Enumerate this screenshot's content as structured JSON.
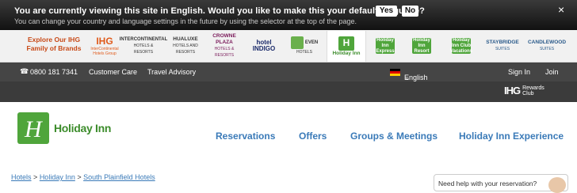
{
  "language_banner": {
    "question": "You are currently viewing this site in English. Would you like to make this your default language?",
    "subtext": "You can change your country and language settings in the future by using the selector at the top of the page.",
    "yes_label": "Yes",
    "no_label": "No",
    "close": "×"
  },
  "brands": {
    "intro": "Explore Our IHG Family of Brands",
    "items": [
      {
        "name": "IHG",
        "sub": "InterContinental Hotels Group"
      },
      {
        "name": "INTERCONTINENTAL",
        "sub": "HOTELS & RESORTS"
      },
      {
        "name": "HUALUXE",
        "sub": "HOTELS AND RESORTS"
      },
      {
        "name": "CROWNE PLAZA",
        "sub": "HOTELS & RESORTS"
      },
      {
        "name": "hotel INDIGO",
        "sub": ""
      },
      {
        "name": "EVEN",
        "sub": "HOTELS"
      },
      {
        "name": "Holiday Inn",
        "sub": ""
      },
      {
        "name": "Holiday Inn Express",
        "sub": ""
      },
      {
        "name": "Holiday Inn Resort",
        "sub": ""
      },
      {
        "name": "Holiday Inn Club Vacations",
        "sub": ""
      },
      {
        "name": "STAYBRIDGE",
        "sub": "SUITES"
      },
      {
        "name": "CANDLEWOOD",
        "sub": "SUITES"
      }
    ]
  },
  "utility": {
    "phone": "0800 181 7341",
    "customer_care": "Customer Care",
    "travel_advisory": "Travel Advisory",
    "language": "English",
    "sign_in": "Sign In",
    "join": "Join"
  },
  "rewards": {
    "brand": "IHG",
    "label_1": "Rewards",
    "label_2": "Club"
  },
  "header": {
    "logo_text": "Holiday Inn"
  },
  "nav": {
    "reservations": "Reservations",
    "offers": "Offers",
    "groups": "Groups & Meetings",
    "experience": "Holiday Inn Experience"
  },
  "breadcrumb": {
    "c1": "Hotels",
    "sep": ">",
    "c2": "Holiday Inn",
    "c3": "South Plainfield Hotels"
  },
  "help": {
    "text": "Need help with your reservation?"
  },
  "colors": {
    "accent_green": "#4fa53b",
    "link_blue": "#3a7ab8",
    "brand_orange": "#c84a18"
  }
}
